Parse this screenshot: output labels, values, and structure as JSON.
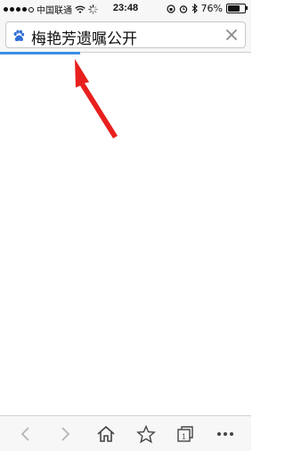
{
  "status_bar": {
    "carrier": "中国联通",
    "time": "23:48",
    "battery_percent": "76%",
    "battery_level": 0.76
  },
  "url_bar": {
    "query": "梅艳芳遗嘱公开",
    "load_progress": 0.32
  },
  "bottom_toolbar": {
    "tabs_count": "1"
  },
  "colors": {
    "progress": "#3a8ee6",
    "annotation_arrow": "#e8201e",
    "baidu_paw": "#2f6fd6"
  }
}
